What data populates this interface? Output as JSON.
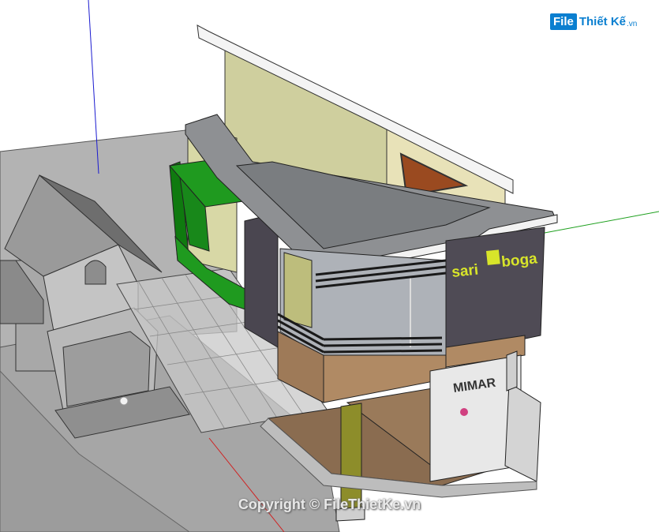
{
  "watermark": {
    "logo_box": "File",
    "logo_text": "Thiết Kế",
    "logo_suffix": ".vn",
    "copyright": "Copyright © FileThietKe.vn"
  },
  "signage": {
    "brand_left": "sari",
    "brand_right": "boga",
    "store_sign": "MIMAR"
  },
  "colors": {
    "ground": "#b4b4b4",
    "roof_gray": "#8e9093",
    "green_canopy": "#1f9a1f",
    "dark_cladding": "#4a4650",
    "beige_wall": "#cfcf9e",
    "stone_base": "#b08a64",
    "glass": "#aeb2b8",
    "brand_yellow": "#d8e52a"
  }
}
